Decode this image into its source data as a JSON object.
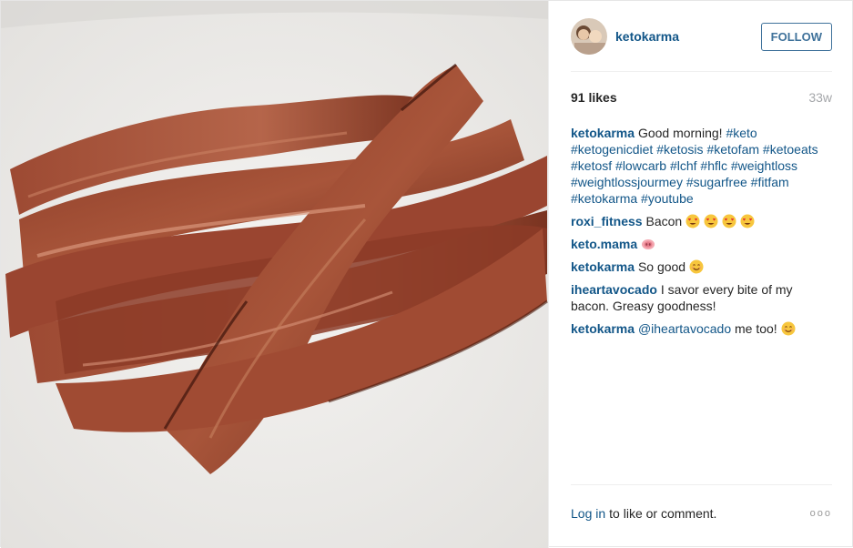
{
  "post": {
    "username": "ketokarma",
    "follow_label": "FOLLOW",
    "likes": "91 likes",
    "age": "33w"
  },
  "photo": {
    "subject": "crispy bacon strips on a white plate"
  },
  "caption": {
    "user": "ketokarma",
    "text": "Good morning!",
    "hashtags": [
      "#keto",
      "#ketogenicdiet",
      "#ketosis",
      "#ketofam",
      "#ketoeats",
      "#ketosf",
      "#lowcarb",
      "#lchf",
      "#hflc",
      "#weightloss",
      "#weightlossjourmey",
      "#sugarfree",
      "#fitfam",
      "#ketokarma",
      "#youtube"
    ]
  },
  "comments": [
    {
      "user": "roxi_fitness",
      "text": "Bacon",
      "emoji": [
        "heart-eyes",
        "heart-eyes",
        "heart-eyes",
        "heart-eyes"
      ]
    },
    {
      "user": "keto.mama",
      "text": "",
      "emoji": [
        "pig-nose"
      ]
    },
    {
      "user": "ketokarma",
      "text": "So good",
      "emoji": [
        "smile"
      ]
    },
    {
      "user": "iheartavocado",
      "text": "I savor every bite of my bacon. Greasy goodness!",
      "emoji": []
    },
    {
      "user": "ketokarma",
      "mention": "@iheartavocado",
      "text": "me too!",
      "emoji": [
        "smile"
      ]
    }
  ],
  "footer": {
    "login_link": "Log in",
    "login_text": "to like or comment.",
    "more": "ooo"
  },
  "colors": {
    "link": "#125688",
    "follow_border": "#3f729b",
    "muted": "#a5a7aa"
  }
}
